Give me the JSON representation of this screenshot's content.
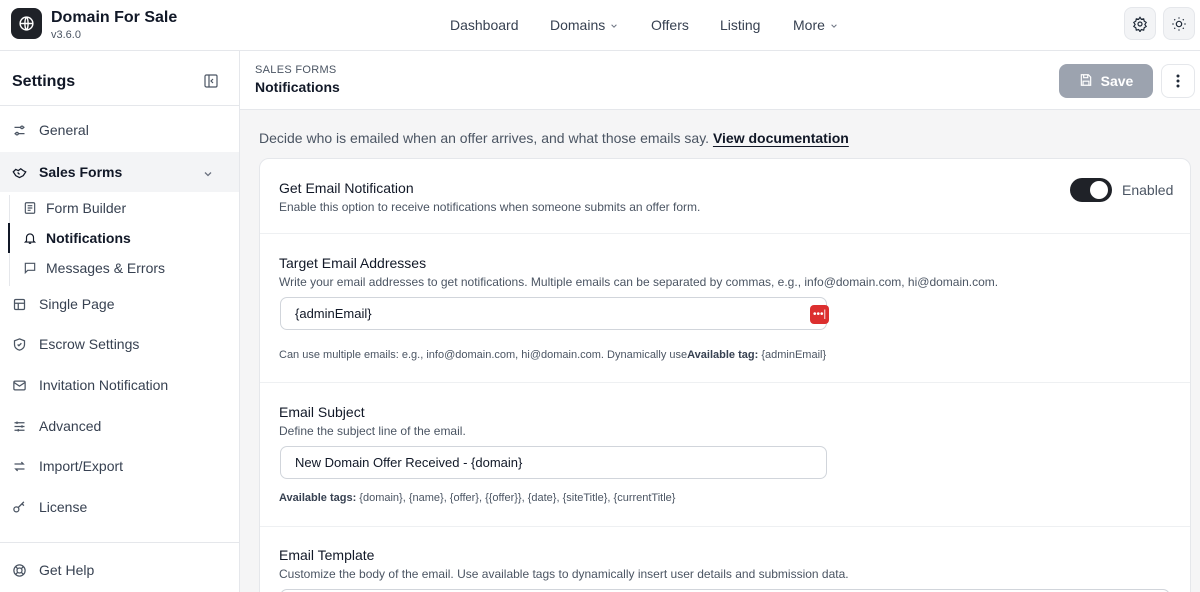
{
  "app": {
    "title": "Domain For Sale",
    "version": "v3.6.0"
  },
  "nav": {
    "items": [
      {
        "label": "Dashboard"
      },
      {
        "label": "Domains"
      },
      {
        "label": "Offers"
      },
      {
        "label": "Listing"
      },
      {
        "label": "More"
      }
    ]
  },
  "sidebar": {
    "title": "Settings",
    "items": [
      {
        "label": "General",
        "icon": "sliders-icon"
      },
      {
        "label": "Sales Forms",
        "icon": "handshake-icon"
      },
      {
        "label": "Single Page",
        "icon": "layout-icon"
      },
      {
        "label": "Escrow Settings",
        "icon": "shield-icon"
      },
      {
        "label": "Invitation Notification",
        "icon": "mail-icon"
      },
      {
        "label": "Advanced",
        "icon": "adjustments-icon"
      },
      {
        "label": "Import/Export",
        "icon": "arrows-icon"
      },
      {
        "label": "License",
        "icon": "key-icon"
      }
    ],
    "sub_items": [
      {
        "label": "Form Builder",
        "icon": "form-icon"
      },
      {
        "label": "Notifications",
        "icon": "bell-icon"
      },
      {
        "label": "Messages & Errors",
        "icon": "message-icon"
      }
    ],
    "help": "Get Help"
  },
  "header": {
    "breadcrumb": "SALES FORMS",
    "title": "Notifications",
    "save_label": "Save"
  },
  "intro": {
    "text": "Decide who is emailed when an offer arrives, and what those emails say.",
    "link": "View documentation"
  },
  "fields": {
    "email_notification": {
      "title": "Get Email Notification",
      "desc": "Enable this option to receive notifications when someone submits an offer form.",
      "toggle_label": "Enabled",
      "enabled": true
    },
    "target_emails": {
      "title": "Target Email Addresses",
      "desc": "Write your email addresses to get notifications. Multiple emails can be separated by commas, e.g., info@domain.com, hi@domain.com.",
      "value": "{adminEmail}",
      "hint_text": "Can use multiple emails: e.g., info@domain.com, hi@domain.com. Dynamically use",
      "hint_label": "Available tag:",
      "hint_tags": "{adminEmail}"
    },
    "email_subject": {
      "title": "Email Subject",
      "desc": "Define the subject line of the email.",
      "value": "New Domain Offer Received - {domain}",
      "hint_label": "Available tags:",
      "hint_tags": "{domain}, {name}, {offer}, {{offer}}, {date}, {siteTitle}, {currentTitle}"
    },
    "email_template": {
      "title": "Email Template",
      "desc": "Customize the body of the email. Use available tags to dynamically insert user details and submission data."
    }
  },
  "colors": {
    "accent": "#1f2228",
    "save_disabled": "#9ca3af",
    "password_icon": "#dc2f2f"
  }
}
